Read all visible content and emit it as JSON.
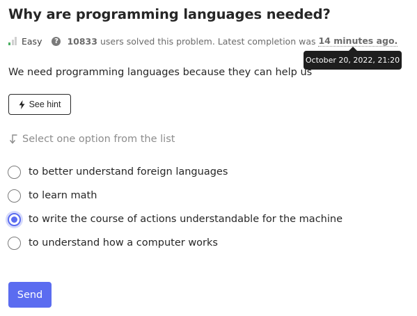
{
  "problem": {
    "title": "Why are programming languages needed?",
    "difficulty": "Easy",
    "help_icon": "?",
    "solved_count": "10833",
    "solved_text": "users solved this problem. Latest completion was",
    "latest_completion": "14 minutes ago.",
    "tooltip": "October 20, 2022, 21:20",
    "statement": "We need programming languages because they can help us"
  },
  "hint": {
    "label": "See hint",
    "icon": "lightning-icon"
  },
  "prompt": {
    "label": "Select one option from the list",
    "icon": "arrow-down-corner-icon"
  },
  "options": [
    {
      "label": "to better understand foreign languages",
      "checked": false
    },
    {
      "label": "to learn math",
      "checked": false
    },
    {
      "label": "to write the course of actions understandable for the machine",
      "checked": true
    },
    {
      "label": "to understand how a computer works",
      "checked": false
    }
  ],
  "actions": {
    "send_label": "Send"
  },
  "colors": {
    "accent": "#5b6cf0",
    "easy": "#4caf63",
    "tooltip_bg": "#1e1e1e"
  }
}
